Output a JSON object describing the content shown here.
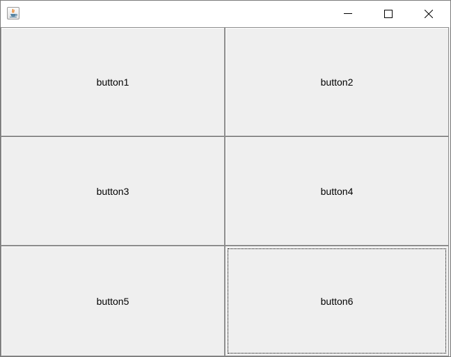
{
  "window": {
    "icon": "java-coffee-cup-icon",
    "controls": {
      "minimize_icon": "minimize-icon",
      "maximize_icon": "maximize-icon",
      "close_icon": "close-icon"
    }
  },
  "buttons": [
    {
      "label": "button1",
      "focused": false
    },
    {
      "label": "button2",
      "focused": false
    },
    {
      "label": "button3",
      "focused": false
    },
    {
      "label": "button4",
      "focused": false
    },
    {
      "label": "button5",
      "focused": false
    },
    {
      "label": "button6",
      "focused": true
    }
  ],
  "colors": {
    "button_face": "#efefef",
    "titlebar": "#ffffff",
    "border": "#8c8c8c"
  }
}
